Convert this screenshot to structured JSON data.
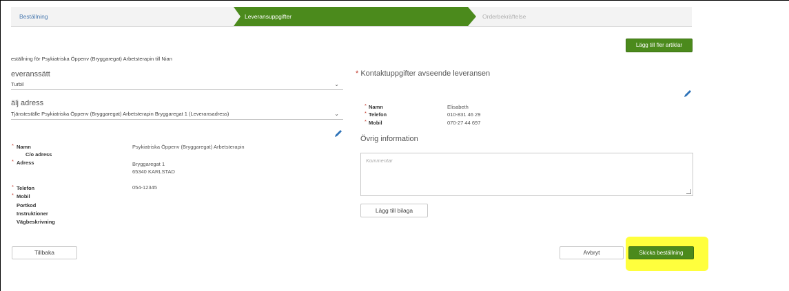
{
  "stepper": {
    "steps": [
      {
        "label": "Beställning",
        "state": "done"
      },
      {
        "label": "Leveransuppgifter",
        "state": "active"
      },
      {
        "label": "Orderbekräftelse",
        "state": "upcoming"
      }
    ]
  },
  "toolbar": {
    "add_articles_label": "Lägg till fler artiklar"
  },
  "order_for": "eställning för Psykiatriska Öppenv (Bryggaregat) Arbetsterapin till Nian",
  "delivery_method": {
    "label": "everanssätt",
    "selected": "Turbil"
  },
  "address_select": {
    "label": "älj adress",
    "selected": "Tjänsteställe Psykiatriska Öppenv (Bryggaregat) Arbetsterapin Bryggaregat 1 (Leveransadress)"
  },
  "address_details": {
    "name_label": "Namn",
    "name_value": "Psykiatriska Öppenv (Bryggaregat) Arbetsterapin",
    "co_label": "C/o adress",
    "address_label": "Adress",
    "address_line1": "Bryggaregat 1",
    "address_line2": "65340 KARLSTAD",
    "phone_label": "Telefon",
    "phone_value": "054-12345",
    "mobile_label": "Mobil",
    "portcode_label": "Portkod",
    "instructions_label": "Instruktioner",
    "directions_label": "Vägbeskrivning"
  },
  "contact": {
    "heading": "Kontaktuppgifter avseende leveransen",
    "name_label": "Namn",
    "name_value": "Elisabeth",
    "phone_label": "Telefon",
    "phone_value": "010-831 46 29",
    "mobile_label": "Mobil",
    "mobile_value": "070-27 44 697"
  },
  "other_info": {
    "heading": "Övrig information",
    "comment_placeholder": "Kommentar"
  },
  "buttons": {
    "attach_label": "Lägg till bilaga",
    "back_label": "Tillbaka",
    "cancel_label": "Avbryt",
    "submit_label": "Skicka beställning"
  },
  "colors": {
    "brand_green": "#4b8a1c",
    "link_blue": "#4a7ab0",
    "required_red": "#c0392b",
    "highlight_yellow": "#ffff33"
  },
  "icons": {
    "edit": "pencil-icon",
    "dropdown": "chevron-down-icon"
  }
}
